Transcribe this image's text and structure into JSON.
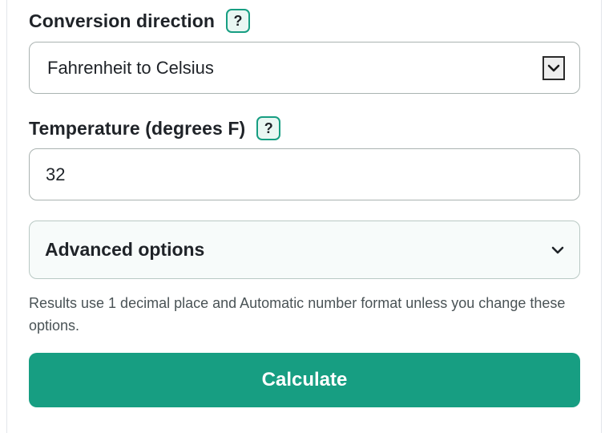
{
  "conversion": {
    "label": "Conversion direction",
    "help": "?",
    "selected": "Fahrenheit to Celsius"
  },
  "temperature": {
    "label": "Temperature (degrees F)",
    "help": "?",
    "value": "32"
  },
  "advanced": {
    "label": "Advanced options"
  },
  "note": "Results use 1 decimal place and Automatic number format unless you change these options.",
  "calculate_label": "Calculate",
  "colors": {
    "accent": "#179e82",
    "help_bg": "#e9f7f3",
    "text": "#1f2328",
    "muted_text": "#4a5356"
  },
  "icons": {
    "select_arrow": "chevron-down-icon",
    "advanced_toggle": "chevron-down-icon"
  }
}
